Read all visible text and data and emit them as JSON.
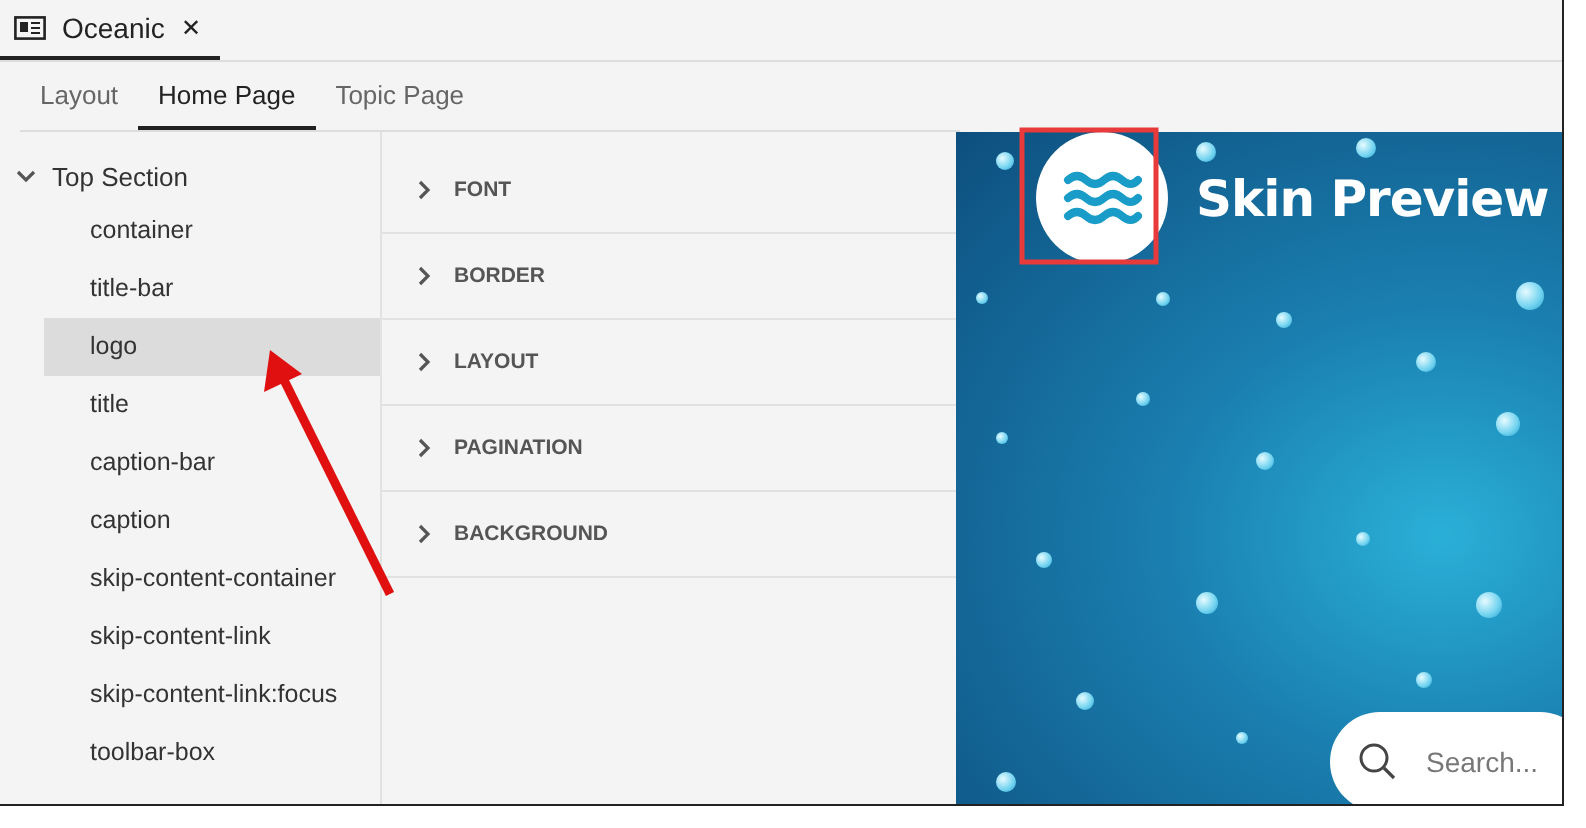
{
  "document_tab": {
    "title": "Oceanic",
    "close": "✕"
  },
  "tabs": [
    {
      "label": "Layout",
      "selected": false
    },
    {
      "label": "Home Page",
      "selected": true
    },
    {
      "label": "Topic Page",
      "selected": false
    }
  ],
  "tree": {
    "label": "Top Section",
    "expanded": true,
    "children": [
      {
        "label": "container",
        "selected": false
      },
      {
        "label": "title-bar",
        "selected": false
      },
      {
        "label": "logo",
        "selected": true
      },
      {
        "label": "title",
        "selected": false
      },
      {
        "label": "caption-bar",
        "selected": false
      },
      {
        "label": "caption",
        "selected": false
      },
      {
        "label": "skip-content-container",
        "selected": false
      },
      {
        "label": "skip-content-link",
        "selected": false
      },
      {
        "label": "skip-content-link:focus",
        "selected": false
      },
      {
        "label": "toolbar-box",
        "selected": false
      }
    ]
  },
  "sections": [
    {
      "label": "FONT",
      "expanded": false
    },
    {
      "label": "BORDER",
      "expanded": false
    },
    {
      "label": "LAYOUT",
      "expanded": false
    },
    {
      "label": "PAGINATION",
      "expanded": false
    },
    {
      "label": "BACKGROUND",
      "expanded": false
    }
  ],
  "preview": {
    "title": "Skin Preview",
    "search": {
      "placeholder": "Search..."
    }
  }
}
